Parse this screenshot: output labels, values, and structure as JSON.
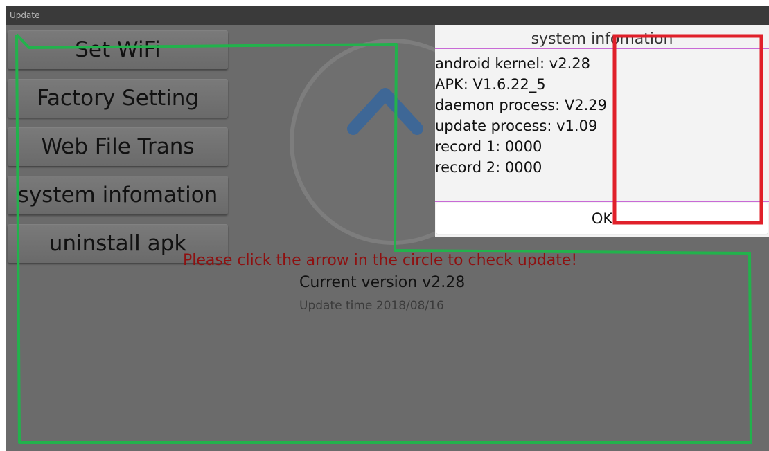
{
  "window": {
    "title": "Update"
  },
  "menu": {
    "items": [
      {
        "label": "Set WiFi"
      },
      {
        "label": "Factory Setting"
      },
      {
        "label": "Web File Trans"
      },
      {
        "label": "system infomation"
      },
      {
        "label": "uninstall apk"
      }
    ]
  },
  "main": {
    "prompt": "Please click the arrow in the circle to check update!",
    "current_version": "Current version  v2.28",
    "update_time": "Update time  2018/08/16",
    "icon": "up-arrow-icon"
  },
  "dialog": {
    "title": "system infomation",
    "lines": [
      "android kernel: v2.28",
      "APK: V1.6.22_5",
      "daemon process: V2.29",
      "update process: v1.09",
      "record 1: 0000",
      "record 2: 0000"
    ],
    "ok_label": "OK"
  },
  "colors": {
    "annotation_green": "#22b24c",
    "annotation_red": "#e0202a",
    "prompt_red": "#8e1010",
    "dialog_divider": "#c86ad6"
  }
}
